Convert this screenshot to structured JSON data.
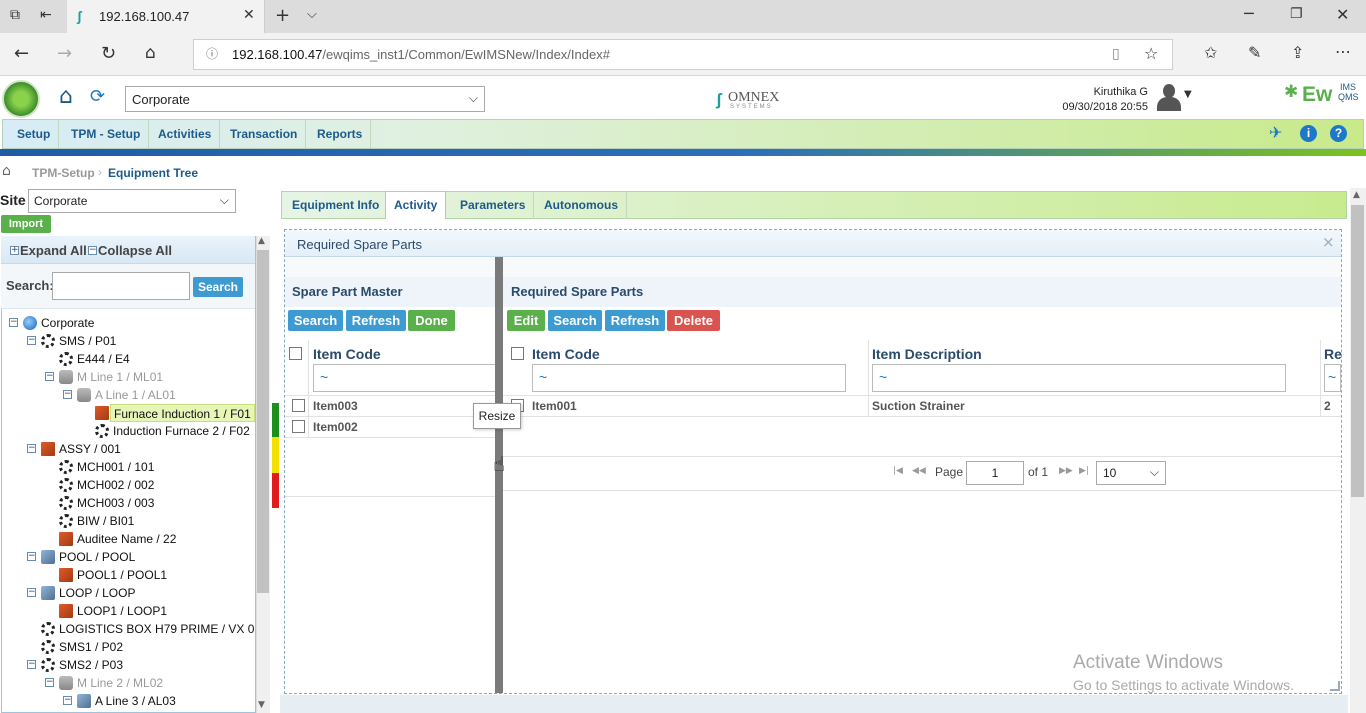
{
  "browser": {
    "tab_title": "192.168.100.47",
    "url_host": "192.168.100.47",
    "url_path": "/ewqims_inst1/Common/EwIMSNew/Index/Index#"
  },
  "header": {
    "site_select": "Corporate",
    "brand_center": "OMNEX",
    "brand_center_sub": "SYSTEMS",
    "user_name": "Kiruthika G",
    "datetime": "09/30/2018 20:55",
    "brand_right": "Ew",
    "brand_right_sup": "IMS",
    "brand_right_sub": "QMS"
  },
  "menu": [
    "Setup",
    "TPM - Setup",
    "Activities",
    "Transaction",
    "Reports"
  ],
  "breadcrumb": {
    "parent": "TPM-Setup",
    "current": "Equipment Tree"
  },
  "left": {
    "site_label": "Site",
    "site_value": "Corporate",
    "import_label": "Import",
    "expand_all": "Expand All",
    "collapse_all": "Collapse All",
    "search_label": "Search:",
    "search_btn": "Search",
    "tree": [
      {
        "label": "Corporate",
        "level": 0,
        "icon": "globe",
        "exp": "-"
      },
      {
        "label": "SMS / P01",
        "level": 1,
        "icon": "gear",
        "exp": "-"
      },
      {
        "label": "E444 / E4",
        "level": 2,
        "icon": "gear",
        "exp": ""
      },
      {
        "label": "M Line 1 / ML01",
        "level": 2,
        "icon": "gray",
        "exp": "-",
        "dim": true
      },
      {
        "label": "A Line 1 / AL01",
        "level": 3,
        "icon": "gray",
        "exp": "-",
        "dim": true
      },
      {
        "label": "Furnace Induction 1 / F01",
        "level": 4,
        "icon": "box",
        "exp": "",
        "selected": true
      },
      {
        "label": "Induction Furnace 2 / F02",
        "level": 4,
        "icon": "gear",
        "exp": ""
      },
      {
        "label": "ASSY / 001",
        "level": 1,
        "icon": "box",
        "exp": "-"
      },
      {
        "label": "MCH001 / 101",
        "level": 2,
        "icon": "gear",
        "exp": ""
      },
      {
        "label": "MCH002 / 002",
        "level": 2,
        "icon": "gear",
        "exp": ""
      },
      {
        "label": "MCH003 / 003",
        "level": 2,
        "icon": "gear",
        "exp": ""
      },
      {
        "label": "BIW / BI01",
        "level": 2,
        "icon": "gear",
        "exp": ""
      },
      {
        "label": "Auditee Name / 22",
        "level": 2,
        "icon": "box",
        "exp": ""
      },
      {
        "label": "POOL / POOL",
        "level": 1,
        "icon": "pool",
        "exp": "-"
      },
      {
        "label": "POOL1 / POOL1",
        "level": 2,
        "icon": "box",
        "exp": ""
      },
      {
        "label": "LOOP / LOOP",
        "level": 1,
        "icon": "pool",
        "exp": "-"
      },
      {
        "label": "LOOP1 / LOOP1",
        "level": 2,
        "icon": "box",
        "exp": ""
      },
      {
        "label": "LOGISTICS BOX H79 PRIME / VX 01",
        "level": 1,
        "icon": "gear",
        "exp": ""
      },
      {
        "label": "SMS1 / P02",
        "level": 1,
        "icon": "gear",
        "exp": ""
      },
      {
        "label": "SMS2 / P03",
        "level": 1,
        "icon": "gear",
        "exp": "-"
      },
      {
        "label": "M Line 2 / ML02",
        "level": 2,
        "icon": "gray",
        "exp": "-",
        "dim": true
      },
      {
        "label": "A Line 3 / AL03",
        "level": 3,
        "icon": "pool",
        "exp": "-"
      }
    ]
  },
  "tabs": [
    "Equipment Info",
    "Activity",
    "Parameters",
    "Autonomous"
  ],
  "dialog": {
    "title": "Required Spare Parts",
    "close": "×",
    "master": {
      "title": "Spare Part Master",
      "buttons": [
        "Search",
        "Refresh",
        "Done"
      ],
      "col_item_code": "Item Code",
      "filter": "~",
      "rows": [
        "Item003",
        "Item002"
      ]
    },
    "required": {
      "title": "Required Spare Parts",
      "buttons": [
        "Edit",
        "Search",
        "Refresh",
        "Delete"
      ],
      "col_item_code": "Item Code",
      "col_item_desc": "Item Description",
      "col_third": "Re",
      "filter": "~",
      "rows": [
        {
          "code": "Item001",
          "desc": "Suction Strainer",
          "third": "2"
        }
      ],
      "pager": {
        "page_label": "Page",
        "page_value": "1",
        "of_label": "of 1",
        "page_size": "10"
      }
    },
    "resize_tip": "Resize"
  },
  "watermark": {
    "line1": "Activate Windows",
    "line2": "Go to Settings to activate Windows."
  },
  "colors": {
    "accent": "#1d5a8c",
    "green": "#5ab04b",
    "red": "#d9534f",
    "blue_btn": "#3d9bd2"
  }
}
